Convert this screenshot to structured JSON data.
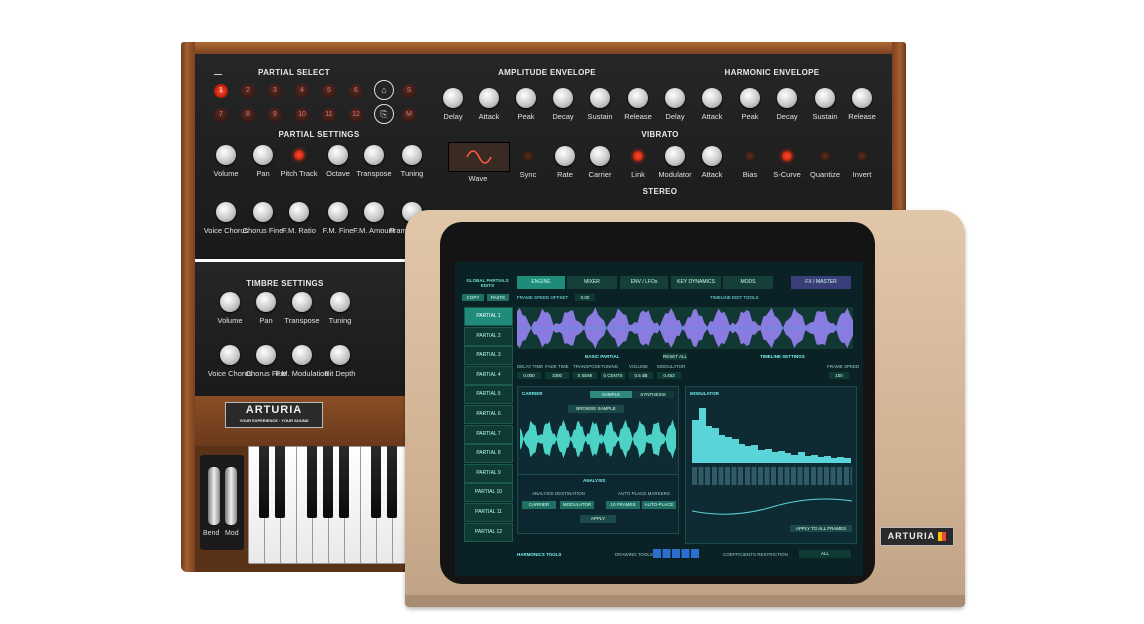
{
  "synth": {
    "partial_select": {
      "title": "PARTIAL SELECT",
      "row1": [
        "1",
        "2",
        "3",
        "4",
        "5",
        "6"
      ],
      "row2": [
        "7",
        "8",
        "9",
        "10",
        "11",
        "12"
      ],
      "side": [
        "S",
        "M"
      ]
    },
    "partial_settings": {
      "title": "PARTIAL SETTINGS",
      "row1": [
        "Volume",
        "Pan",
        "Pitch Track",
        "Octave",
        "Transpose",
        "Tuning"
      ],
      "row2": [
        "Voice Chorus",
        "Chorus Fine",
        "F.M. Ratio",
        "F.M. Fine",
        "F.M. Amount",
        "Frame Speed"
      ]
    },
    "amplitude_envelope": {
      "title": "AMPLITUDE ENVELOPE",
      "labels": [
        "Delay",
        "Attack",
        "Peak",
        "Decay",
        "Sustain",
        "Release"
      ]
    },
    "harmonic_envelope": {
      "title": "HARMONIC ENVELOPE",
      "labels": [
        "Delay",
        "Attack",
        "Peak",
        "Decay",
        "Sustain",
        "Release"
      ]
    },
    "vibrato": {
      "title": "VIBRATO",
      "labels": [
        "Wave",
        "Sync",
        "Rate",
        "Carrier",
        "Link",
        "Modulator",
        "Attack",
        "Bias",
        "S-Curve",
        "Quantize",
        "Invert"
      ]
    },
    "stereo": {
      "title": "STEREO"
    },
    "timbre_settings": {
      "title": "TIMBRE SETTINGS",
      "row1": [
        "Volume",
        "Pan",
        "Transpose",
        "Tuning"
      ],
      "row2": [
        "Voice Chorus",
        "Chorus Fine",
        "F.M. Modulation",
        "Bit Depth"
      ]
    },
    "logo": "ARTURIA",
    "logo_tagline": "YOUR EXPERIENCE · YOUR SOUND",
    "wheels": {
      "bend": "Bend",
      "mod": "Mod"
    }
  },
  "monitor": {
    "logo": "ARTURIA",
    "header": {
      "global": "GLOBAL PARTIALS EDITS",
      "copy": "COPY",
      "paste": "PASTE",
      "tabs": [
        "ENGINE",
        "MIXER",
        "ENV / LFOs",
        "KEY DYNAMICS",
        "MODS",
        "FX / MASTER"
      ]
    },
    "partials": [
      "PARTIAL 1",
      "PARTIAL 2",
      "PARTIAL 3",
      "PARTIAL 4",
      "PARTIAL 5",
      "PARTIAL 6",
      "PARTIAL 7",
      "PARTIAL 8",
      "PARTIAL 9",
      "PARTIAL 10",
      "PARTIAL 11",
      "PARTIAL 12"
    ],
    "selected_partial": 0,
    "frame_speed_offset": {
      "label": "FRAME SPEED OFFSET",
      "value": "0.00"
    },
    "timeline_edit_tools": "TIMELINE EDIT TOOLS",
    "basic_partial": {
      "title": "BASIC PARTIAL",
      "reset": "RESET ALL",
      "fields": [
        {
          "label": "DELAY TIME",
          "value": "0.000"
        },
        {
          "label": "FADE TIME",
          "value": "1000"
        },
        {
          "label": "TRANSPOSE",
          "value": "0 SEMI"
        },
        {
          "label": "TUNING",
          "value": "0 CENTS"
        },
        {
          "label": "VOLUME",
          "value": "0.5 dB"
        },
        {
          "label": "MODULATOR",
          "value": "0.453"
        }
      ]
    },
    "timeline_settings": {
      "title": "TIMELINE SETTINGS",
      "frame_speed": "FRAME SPEED",
      "frame_speed_value": "100"
    },
    "carrier": {
      "title": "CARRIER",
      "sample": "SAMPLE",
      "synthesis": "SYNTHESIS",
      "browse": "BROWSE SAMPLE"
    },
    "modulator": {
      "title": "MODULATOR",
      "bars": [
        0.72,
        0.92,
        0.62,
        0.58,
        0.46,
        0.44,
        0.4,
        0.32,
        0.28,
        0.3,
        0.22,
        0.24,
        0.18,
        0.2,
        0.16,
        0.14,
        0.18,
        0.12,
        0.14,
        0.1,
        0.12,
        0.09,
        0.1,
        0.08
      ]
    },
    "analysis": {
      "title": "ANALYSIS",
      "dest_label": "ANALYSIS DESTINATION",
      "place_label": "AUTO PLACE MARKERS",
      "carrier": "CARRIER",
      "modulator": "MODULATOR",
      "frames": "10 FRAMES",
      "auto_place": "AUTO-PLACE",
      "apply": "APPLY"
    },
    "apply_all": "APPLY TO ALL FRAMES",
    "footer": {
      "harmonics_tools": "HARMONICS TOOLS",
      "drawing_tools": "DRAWING TOOLS",
      "coefficients": "COEFFICIENTS RESTRICTION",
      "all": "ALL"
    }
  },
  "colors": {
    "accent": "#5ad4d9",
    "led": "#ff3a1a",
    "wood": "#a3602f",
    "monitor": "#d8bc9d"
  }
}
